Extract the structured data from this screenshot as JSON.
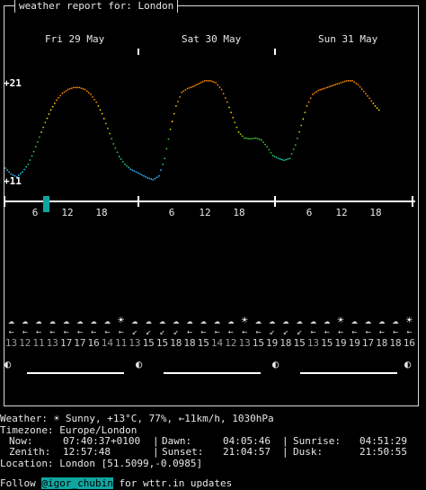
{
  "header": {
    "title": "weather report for: London"
  },
  "days": [
    "Fri 29 May",
    "Sat 30 May",
    "Sun 31 May"
  ],
  "chart_data": {
    "type": "line",
    "title": "",
    "ytick_labels": [
      "+21",
      "+11"
    ],
    "ylim": [
      11,
      21
    ],
    "x_tick_labels": [
      "6",
      "12",
      "18",
      "6",
      "12",
      "18",
      "6",
      "12",
      "18"
    ],
    "current_hour": 9,
    "x_hours": [
      0,
      1,
      2,
      3,
      4,
      5,
      6,
      7,
      8,
      9,
      10,
      11,
      12,
      13,
      14,
      15,
      16,
      17,
      18,
      19,
      20,
      21,
      22,
      23,
      24,
      25,
      26,
      27,
      28,
      29,
      30,
      31,
      32,
      33,
      34,
      35,
      36,
      37,
      38,
      39,
      40,
      41,
      42,
      43,
      44,
      45,
      46,
      47,
      48,
      49,
      50,
      51,
      52,
      53,
      54,
      55,
      56,
      57,
      58,
      59,
      60,
      61,
      62,
      63,
      64,
      65,
      66,
      67,
      68,
      69,
      70,
      71
    ],
    "temperatures": [
      12.2,
      11.6,
      11.3,
      11.8,
      12.6,
      13.9,
      15.4,
      16.9,
      18.2,
      19.2,
      19.9,
      20.3,
      20.5,
      20.5,
      20.3,
      19.8,
      19.0,
      17.8,
      16.3,
      14.7,
      13.4,
      12.6,
      12.1,
      11.8,
      11.5,
      11.2,
      11.0,
      11.4,
      13.2,
      16.2,
      18.6,
      20.0,
      20.4,
      20.6,
      20.9,
      21.2,
      21.2,
      21.0,
      20.3,
      19.0,
      17.4,
      15.9,
      15.3,
      15.2,
      15.3,
      15.1,
      14.4,
      13.5,
      13.2,
      13.0,
      13.2,
      14.6,
      16.6,
      18.6,
      19.8,
      20.2,
      20.4,
      20.6,
      20.8,
      21.0,
      21.2,
      21.2,
      20.8,
      20.1,
      19.4,
      18.6,
      18.0,
      0,
      0,
      0,
      0,
      0
    ]
  },
  "forecast": {
    "icons": [
      "☁",
      "☁",
      "☁",
      "☁",
      "☁",
      "☁",
      "☁",
      "☁",
      "☀",
      "☁",
      "☁",
      "☁",
      "☁",
      "☁",
      "☁",
      "☁",
      "☁",
      "☀",
      "☁",
      "☁",
      "☁",
      "☁",
      "☁",
      "☁",
      "☀",
      "☁",
      "☁",
      "☁",
      "☁",
      "☀"
    ],
    "winds": [
      "←",
      "←",
      "←",
      "←",
      "←",
      "←",
      "←",
      "←",
      "←",
      "↙",
      "↙",
      "↙",
      "↙",
      "←",
      "←",
      "←",
      "←",
      "←",
      "←",
      "↙",
      "↙",
      "↙",
      "←",
      "←",
      "←",
      "←",
      "←",
      "←",
      "←",
      "←"
    ],
    "temps": [
      "13",
      "12",
      "11",
      "13",
      "17",
      "17",
      "16",
      "14",
      "11",
      "13",
      "15",
      "15",
      "18",
      "18",
      "15",
      "14",
      "12",
      "13",
      "15",
      "19",
      "18",
      "15",
      "13",
      "15",
      "19",
      "19",
      "17",
      "18",
      "18",
      "16"
    ],
    "wind_colors": [
      "#cfcfcf",
      "#cfcfcf",
      "#cfcfcf",
      "#cfcfcf",
      "#cfcfcf",
      "#cfcfcf",
      "#cfcfcf",
      "#cfcfcf",
      "#cfcfcf",
      "#cfcfcf",
      "#cfcfcf",
      "#cfcfcf",
      "#cfcfcf",
      "#cfcfcf",
      "#cfcfcf",
      "#cfcfcf",
      "#cfcfcf",
      "#cfcfcf",
      "#cfcfcf",
      "#cfcfcf",
      "#cfcfcf",
      "#cfcfcf",
      "#cfcfcf",
      "#cfcfcf",
      "#cfcfcf",
      "#cfcfcf",
      "#cfcfcf",
      "#cfcfcf",
      "#cfcfcf",
      "#cfcfcf"
    ]
  },
  "moon_icon": "◐",
  "info": {
    "weather_label": "Weather:",
    "weather_value": "☀ Sunny, +13°C, 77%, ←11km/h, 1030hPa",
    "timezone_label": "Timezone:",
    "timezone_value": "Europe/London",
    "now_label": "Now:",
    "now_value": "07:40:37+0100",
    "dawn_label": "Dawn:",
    "dawn_value": "04:05:46",
    "sunrise_label": "Sunrise:",
    "sunrise_value": "04:51:29",
    "zenith_label": "Zenith:",
    "zenith_value": "12:57:48",
    "sunset_label": "Sunset:",
    "sunset_value": "21:04:57",
    "dusk_label": "Dusk:",
    "dusk_value": "21:50:55",
    "location_label": "Location:",
    "location_value": "London [51.5099,-0.0985]",
    "follow_prefix": "Follow ",
    "follow_handle": "@igor_chubin",
    "follow_suffix": " for wttr.in updates"
  },
  "colors": {
    "accent": "#0fa6a0"
  }
}
